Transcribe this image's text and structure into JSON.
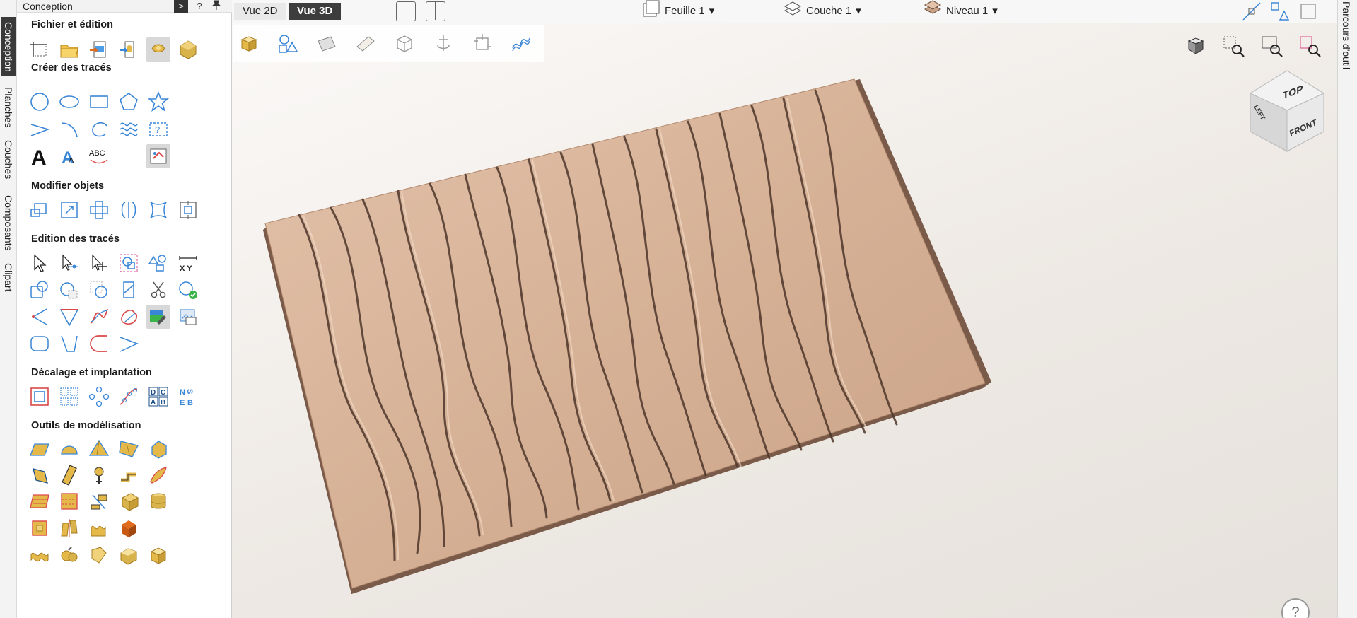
{
  "panel": {
    "title": "Conception",
    "expand_glyph": ">",
    "help_glyph": "?",
    "pin_glyph": "📌"
  },
  "side_tabs": [
    "Conception",
    "Planches",
    "Couches",
    "Composants",
    "Clipart"
  ],
  "sections": {
    "fichier": "Fichier et édition",
    "creer": "Créer des tracés",
    "modifier": "Modifier objets",
    "edition": "Edition des tracés",
    "decalage": "Décalage et implantation",
    "outils": "Outils de modélisation"
  },
  "topbar": {
    "view2d": "Vue 2D",
    "view3d": "Vue 3D",
    "sheet": "Feuille 1",
    "layer": "Couche 1",
    "level": "Niveau 1",
    "caret": "▾"
  },
  "viewcube": {
    "top": "TOP",
    "left": "LEFT",
    "front": "FRONT"
  },
  "right_tab": "Parcours d'outil",
  "help": "?",
  "colors": {
    "accent_blue": "#3a86d6",
    "model_tan": "#d9b59c",
    "model_shadow": "#5a4235",
    "gold": "#e5b84a"
  }
}
